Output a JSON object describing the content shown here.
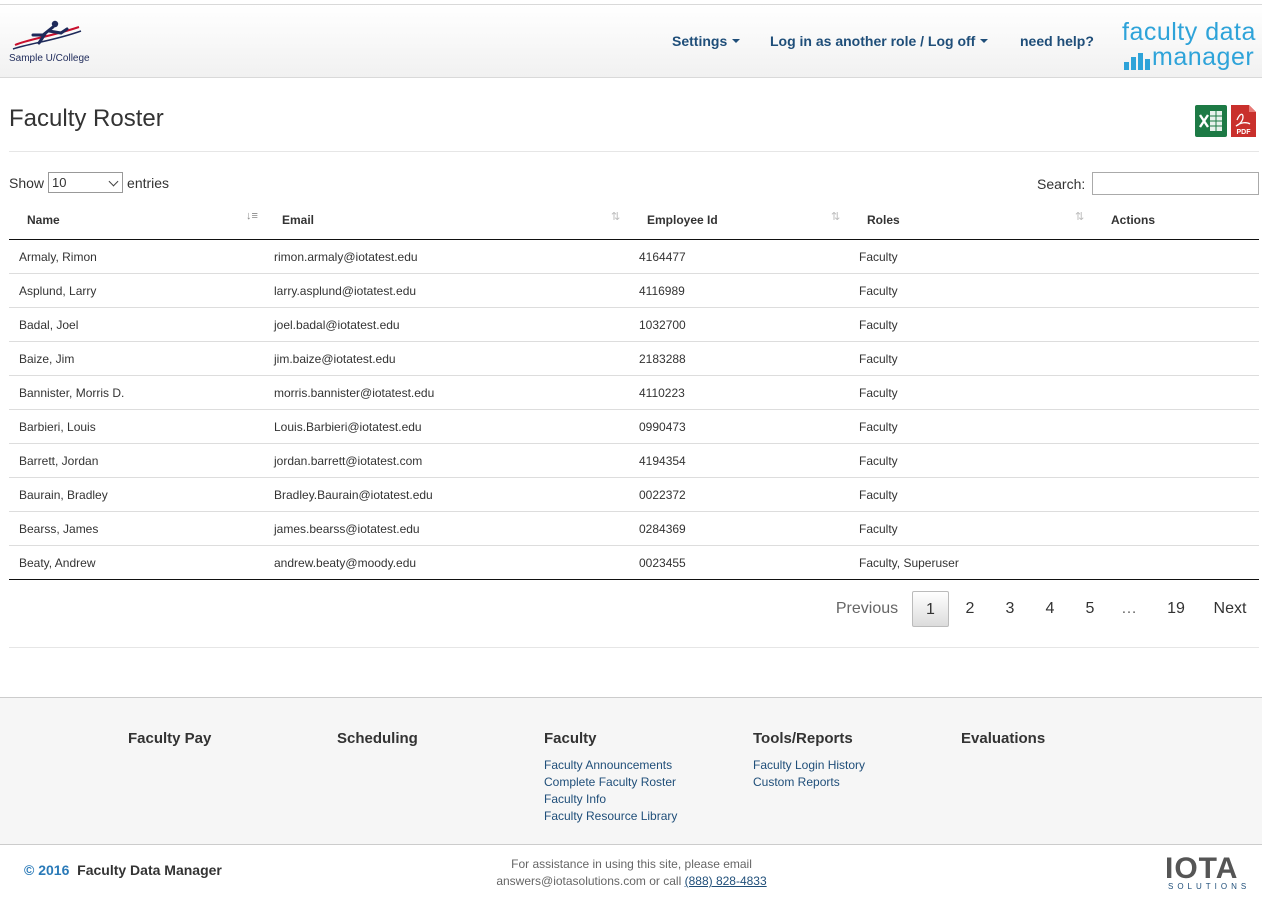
{
  "header": {
    "logo_caption": "Sample U/College",
    "nav": [
      {
        "label": "Settings"
      },
      {
        "label": "Log in as another role / Log off"
      },
      {
        "label": "need help?"
      }
    ],
    "brand_line1": "faculty data",
    "brand_line2": "manager",
    "brand_color": "#2ea3d9"
  },
  "page": {
    "title": "Faculty Roster",
    "excel_icon": "excel-icon",
    "pdf_icon": "pdf-icon",
    "pdf_text": "PDF"
  },
  "controls": {
    "show_label": "Show",
    "show_value": "10",
    "entries_label": "entries",
    "search_label": "Search:",
    "search_value": ""
  },
  "table": {
    "columns": [
      "Name",
      "Email",
      "Employee Id",
      "Roles",
      "Actions"
    ],
    "rows": [
      {
        "name": "Armaly, Rimon",
        "email": "rimon.armaly@iotatest.edu",
        "id": "4164477",
        "roles": "Faculty"
      },
      {
        "name": "Asplund, Larry",
        "email": "larry.asplund@iotatest.edu",
        "id": "4116989",
        "roles": "Faculty"
      },
      {
        "name": "Badal, Joel",
        "email": "joel.badal@iotatest.edu",
        "id": "1032700",
        "roles": "Faculty"
      },
      {
        "name": "Baize, Jim",
        "email": "jim.baize@iotatest.edu",
        "id": "2183288",
        "roles": "Faculty"
      },
      {
        "name": "Bannister, Morris D.",
        "email": "morris.bannister@iotatest.edu",
        "id": "4110223",
        "roles": "Faculty"
      },
      {
        "name": "Barbieri, Louis",
        "email": "Louis.Barbieri@iotatest.edu",
        "id": "0990473",
        "roles": "Faculty"
      },
      {
        "name": "Barrett, Jordan",
        "email": "jordan.barrett@iotatest.com",
        "id": "4194354",
        "roles": "Faculty"
      },
      {
        "name": "Baurain, Bradley",
        "email": "Bradley.Baurain@iotatest.edu",
        "id": "0022372",
        "roles": "Faculty"
      },
      {
        "name": "Bearss, James",
        "email": "james.bearss@iotatest.edu",
        "id": "0284369",
        "roles": "Faculty"
      },
      {
        "name": "Beaty, Andrew",
        "email": "andrew.beaty@moody.edu",
        "id": "0023455",
        "roles": "Faculty, Superuser"
      }
    ]
  },
  "pagination": {
    "previous": "Previous",
    "pages": [
      "1",
      "2",
      "3",
      "4",
      "5",
      "…",
      "19"
    ],
    "current": "1",
    "next": "Next"
  },
  "footer": {
    "columns": [
      {
        "heading": "Faculty Pay",
        "links": []
      },
      {
        "heading": "Scheduling",
        "links": []
      },
      {
        "heading": "Faculty",
        "links": [
          "Faculty Announcements",
          "Complete Faculty Roster",
          "Faculty Info",
          "Faculty Resource Library"
        ]
      },
      {
        "heading": "Tools/Reports",
        "links": [
          "Faculty Login History",
          "Custom Reports"
        ]
      },
      {
        "heading": "Evaluations",
        "links": []
      }
    ],
    "copyright_symbol": "©",
    "copyright_year": "2016",
    "copyright_name": "Faculty Data Manager",
    "assist_line1": "For assistance in using this site, please email",
    "assist_email_part": "answers@iotasolutions.com or call",
    "assist_phone": "(888) 828-4833",
    "iota_word": "IOTA",
    "iota_sub": "SOLUTIONS"
  }
}
